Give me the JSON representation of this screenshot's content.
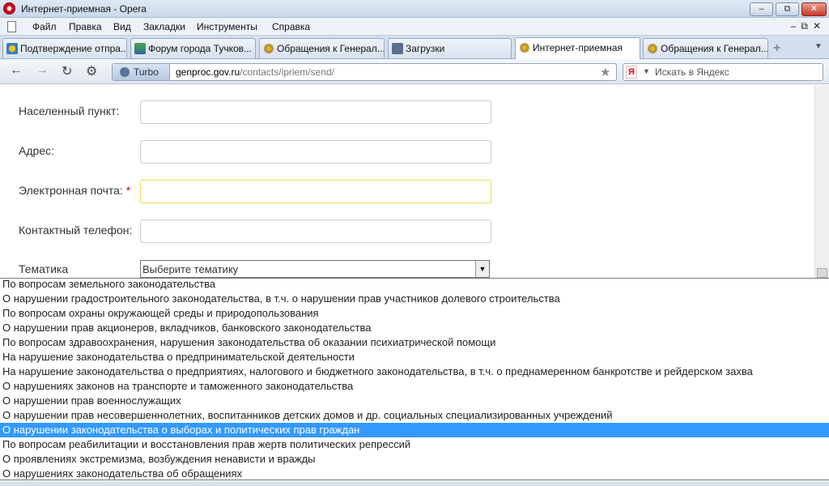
{
  "window": {
    "title": "Интернет-приемная - Opera",
    "controls": [
      "minimize",
      "maximize",
      "close"
    ]
  },
  "menu": {
    "items": [
      "Файл",
      "Правка",
      "Вид",
      "Закладки",
      "Инструменты",
      "Справка"
    ]
  },
  "tabs": [
    {
      "label": "Подтверждение отпра...",
      "icon": "globe-icon",
      "active": false
    },
    {
      "label": "Форум города Тучков...",
      "icon": "forum-icon",
      "active": false
    },
    {
      "label": "Обращения к Генерал...",
      "icon": "emblem-icon",
      "active": false
    },
    {
      "label": "Загрузки",
      "icon": "download-icon",
      "active": false
    },
    {
      "label": "Интернет-приемная",
      "icon": "emblem-icon",
      "active": true
    },
    {
      "label": "Обращения к Генерал...",
      "icon": "emblem-icon",
      "active": false
    }
  ],
  "navigation": {
    "turbo_label": "Turbo",
    "url_host": "genproc.gov.ru",
    "url_path": "/contacts/ipriem/send/",
    "search_placeholder": "Искать в Яндекс"
  },
  "form": {
    "locality_label": "Населенный пункт:",
    "address_label": "Адрес:",
    "email_label": "Электронная почта:",
    "email_required_mark": "*",
    "phone_label": "Контактный телефон:",
    "topic_label": "Тематика",
    "topic_selected": "Выберите тематику"
  },
  "dropdown": {
    "options": [
      "По вопросам земельного законодательства",
      "О нарушении градостроительного законодательства, в т.ч. о нарушении прав участников долевого строительства",
      "По вопросам охраны окружающей среды и природопользования",
      "О нарушении прав акционеров, вкладчиков, банковского законодательства",
      "По вопросам здравоохранения, нарушения законодательства об оказании психиатрической помощи",
      "На нарушение законодательства о предпринимательской деятельности",
      "На нарушение законодательства о предприятиях, налогового и бюджетного законодательства, в т.ч. о преднамеренном банкротстве и рейдерском захва",
      "О нарушениях законов на транспорте и таможенного законодательства",
      "О нарушении прав военнослужащих",
      "О нарушении прав несовершеннолетних, воспитанников детских домов и др. социальных специализированных учреждений",
      "О нарушении законодательства о выборах и политических прав граждан",
      "По вопросам реабилитации и восстановления прав жертв политических репрессий",
      "О проявлениях экстремизма, возбуждения ненависти и вражды",
      "О нарушениях законодательства об обращениях"
    ],
    "highlighted_index": 10,
    "highlight_color": "#3399ff"
  }
}
